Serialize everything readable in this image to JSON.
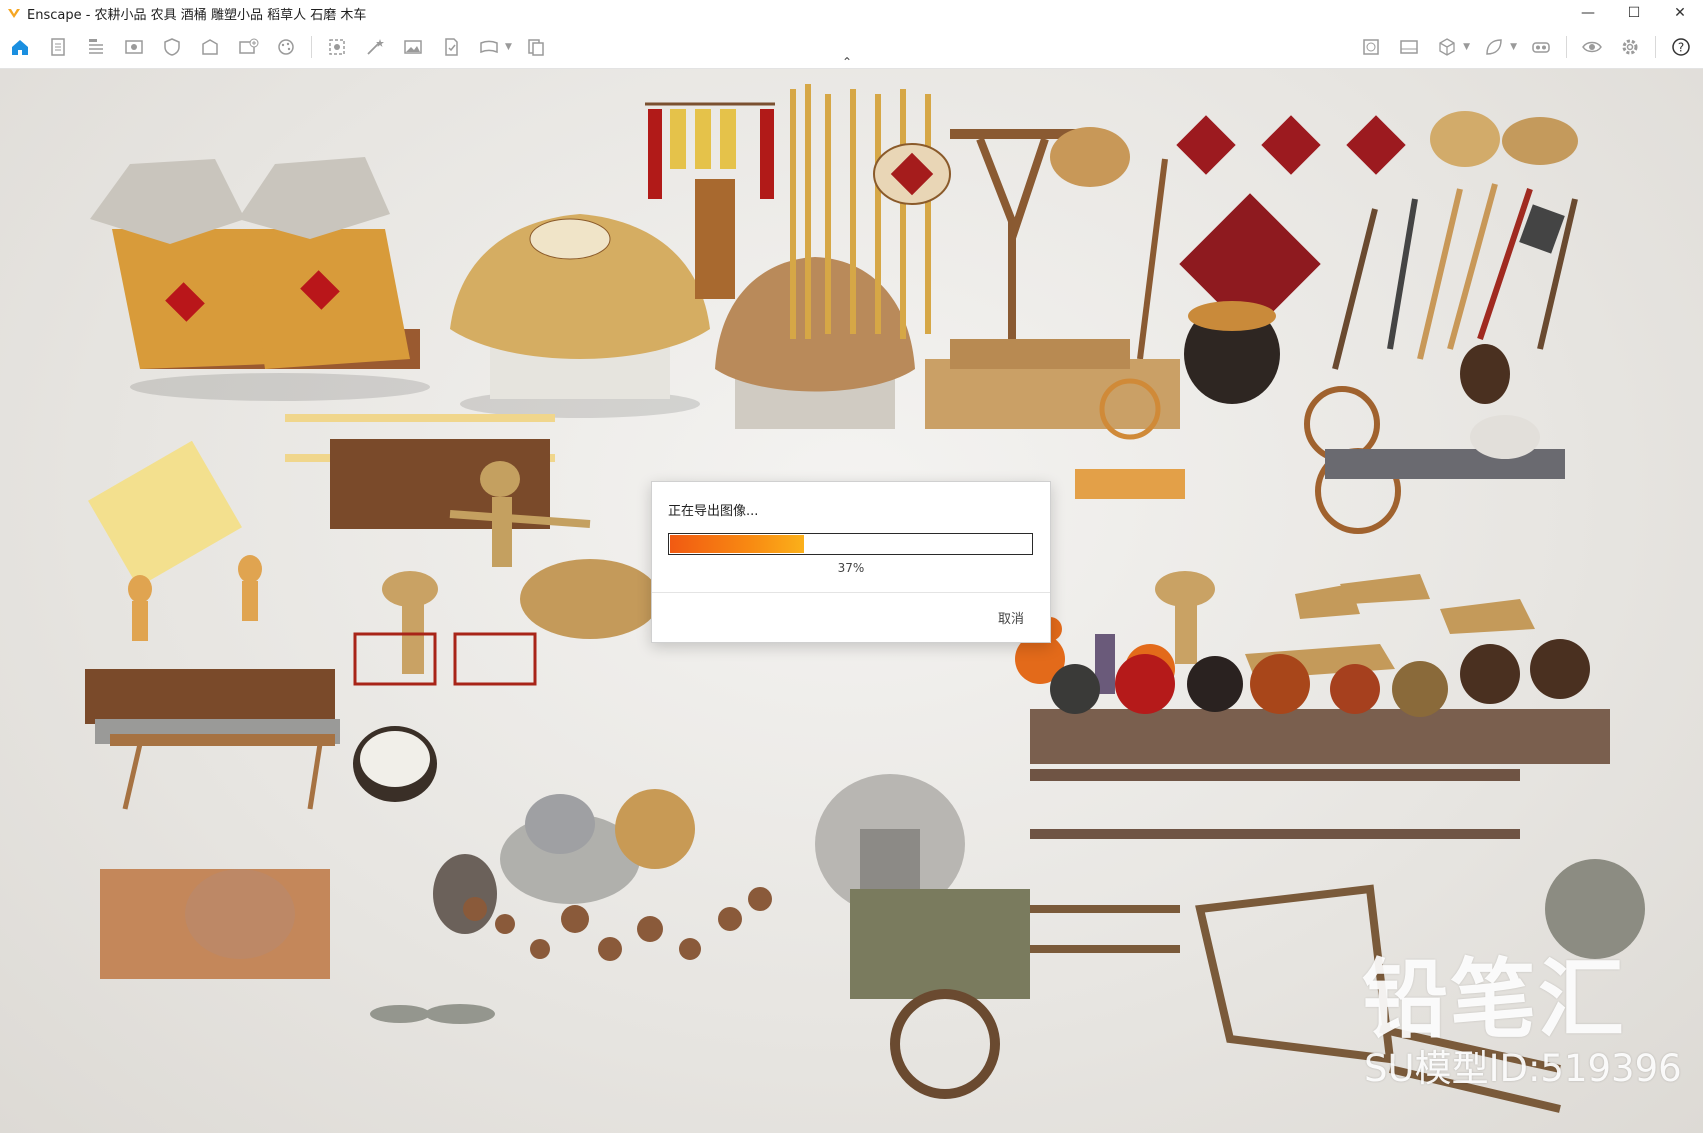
{
  "window": {
    "title": "Enscape - 农耕小品 农具 酒桶 雕塑小品 稻草人 石磨 木车",
    "minimize": "—",
    "maximize": "☐",
    "close": "✕"
  },
  "toolbar": {
    "collapse": "⌃"
  },
  "overlay": {
    "brand": "铅笔汇",
    "model_id": "SU模型ID:519396"
  },
  "dialog": {
    "title": "正在导出图像...",
    "progress": 0.37,
    "progress_text": "37%",
    "cancel": "取消"
  },
  "colors": {
    "accent": "#1a73e8",
    "progress_start": "#f15a12",
    "progress_end": "#fbb01a"
  }
}
